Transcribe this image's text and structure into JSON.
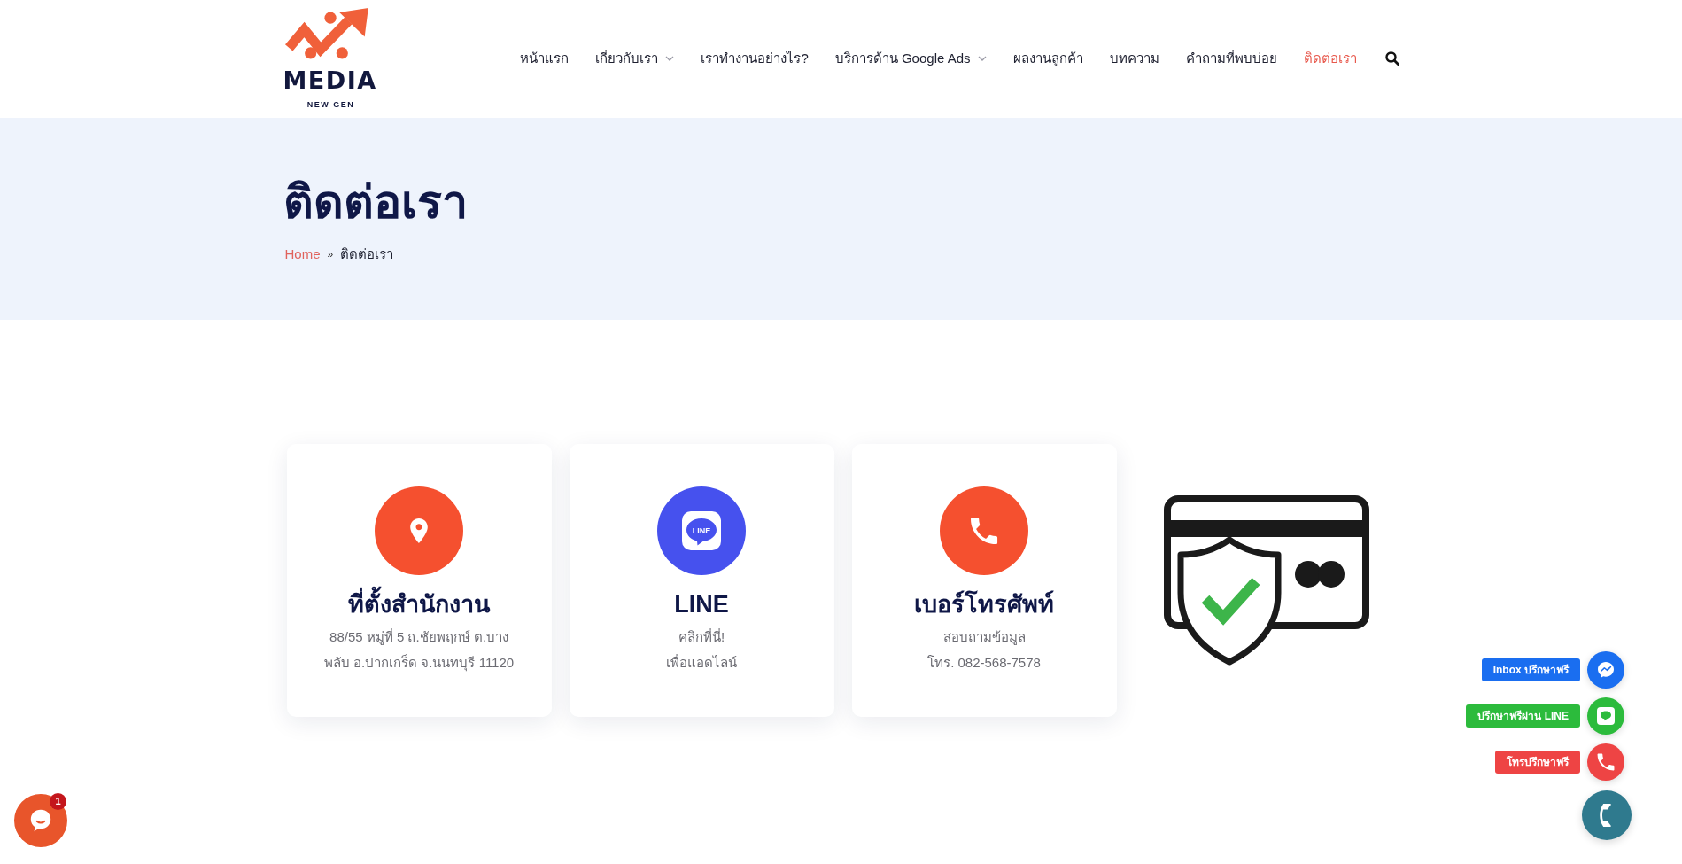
{
  "header": {
    "logo": {
      "wordmark": "MEDIA",
      "tagline": "NEW GEN"
    },
    "nav": [
      {
        "label": "หน้าแรก",
        "dropdown": false,
        "selected": false
      },
      {
        "label": "เกี่ยวกับเรา",
        "dropdown": true,
        "selected": false
      },
      {
        "label": "เราทำงานอย่างไร?",
        "dropdown": false,
        "selected": false
      },
      {
        "label": "บริการด้าน Google Ads",
        "dropdown": true,
        "selected": false
      },
      {
        "label": "ผลงานลูกค้า",
        "dropdown": false,
        "selected": false
      },
      {
        "label": "บทความ",
        "dropdown": false,
        "selected": false
      },
      {
        "label": "คำถามที่พบบ่อย",
        "dropdown": false,
        "selected": false
      },
      {
        "label": "ติดต่อเรา",
        "dropdown": false,
        "selected": true
      }
    ]
  },
  "page_header": {
    "title": "ติดต่อเรา",
    "breadcrumb": [
      {
        "label": "Home",
        "kind": "link"
      },
      {
        "label": "ติดต่อเรา",
        "kind": "current"
      }
    ],
    "separator": "»"
  },
  "contact_cards": [
    {
      "kind": "location",
      "title": "ที่ตั้งสำนักงาน",
      "lines": [
        "88/55 หมู่ที่ 5 ถ.ชัยพฤกษ์ ต.บาง",
        "พลับ อ.ปากเกร็ด จ.นนทบุรี 11120"
      ]
    },
    {
      "kind": "line",
      "logo_text": "LINE",
      "title": "LINE",
      "lines": [
        "คลิกที่นี่!",
        "เพื่อแอดไลน์"
      ]
    },
    {
      "kind": "phone",
      "title": "เบอร์โทรศัพท์",
      "lines": [
        "สอบถามข้อมูล",
        "โทร. 082-568-7578"
      ]
    }
  ],
  "float_buttons": [
    {
      "kind": "messenger",
      "label": "Inbox ปรึกษาฟรี",
      "color": "#1a6ef0"
    },
    {
      "kind": "line",
      "label": "ปรึกษาฟรีผ่าน LINE",
      "color": "#2cbb3c"
    },
    {
      "kind": "call",
      "label": "โทรปรึกษาฟรี",
      "color": "#ee4444"
    }
  ],
  "chat_widget": {
    "badge": "1"
  }
}
